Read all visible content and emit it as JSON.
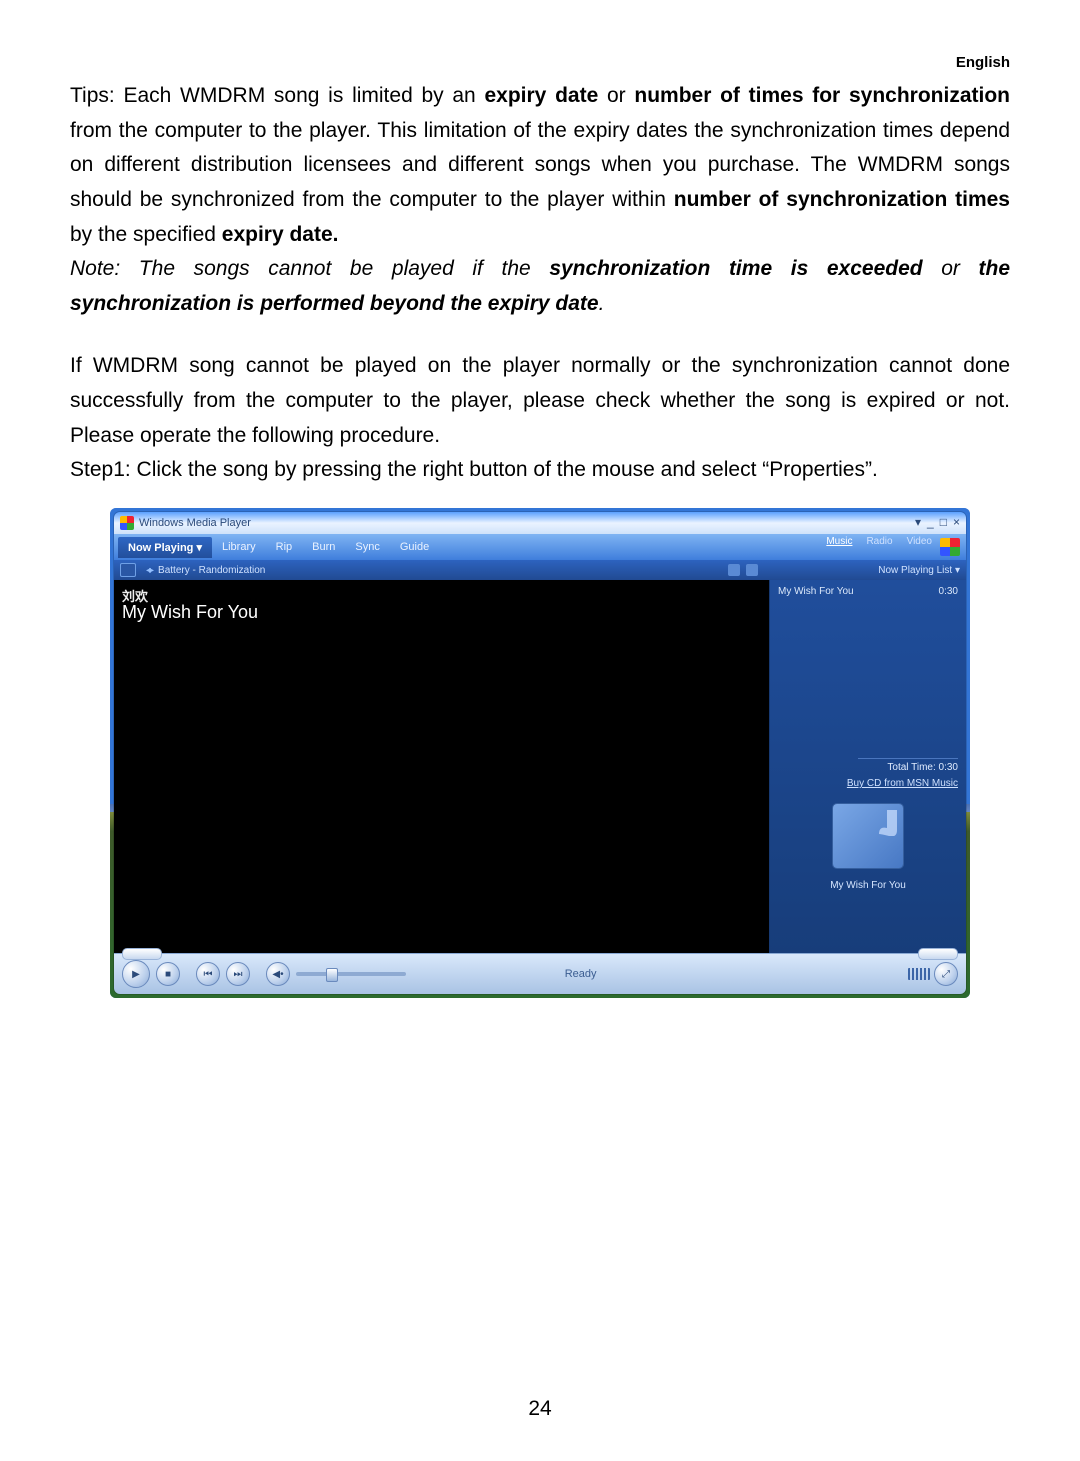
{
  "doc": {
    "language_label": "English",
    "page_number": "24",
    "p1a": "Tips: Each WMDRM song is limited by an ",
    "p1b": "expiry date",
    "p1c": " or ",
    "p1d": "number of times for synchronization",
    "p1e": " from the computer to the player. This limitation of the expiry dates the synchronization times depend on different distribution licensees and different songs when you purchase. The WMDRM songs should be synchronized from the computer to the player within ",
    "p1f": "number of synchronization times",
    "p1g": " by the specified ",
    "p1h": "expiry date.",
    "p2a": "Note: The songs cannot be played if the ",
    "p2b": "synchronization time is exceeded",
    "p2c": " or ",
    "p2d": "the synchronization is performed beyond the expiry date",
    "p2e": ".",
    "p3": "If WMDRM song cannot be played on the player normally or the synchronization cannot done successfully from the computer to the player, please check whether the song is expired or not. Please operate the following procedure.",
    "p4": "Step1: Click the song by pressing the right button of the mouse and select “Properties”."
  },
  "wmp": {
    "app_title": "Windows Media Player",
    "win_ctrl": {
      "down": "▾",
      "min": "_",
      "max": "□",
      "close": "×"
    },
    "tabs": {
      "now_playing": "Now Playing",
      "library": "Library",
      "rip": "Rip",
      "burn": "Burn",
      "sync": "Sync",
      "guide": "Guide"
    },
    "hub": {
      "music": "Music",
      "radio": "Radio",
      "video": "Video"
    },
    "subbar": {
      "label": "Battery - Randomization",
      "now_playing_list": "Now Playing List",
      "arrow": "▾"
    },
    "vis": {
      "artist": "刘欢",
      "song": "My Wish For You"
    },
    "playlist": {
      "song": "My Wish For You",
      "length": "0:30",
      "total": "Total Time: 0:30",
      "promo": "Buy CD from MSN Music",
      "art_label": "My Wish For You"
    },
    "controls": {
      "play": "▶",
      "stop": "■",
      "prev": "⏮",
      "next": "⏭",
      "mute": "◀•",
      "status": "Ready"
    }
  }
}
